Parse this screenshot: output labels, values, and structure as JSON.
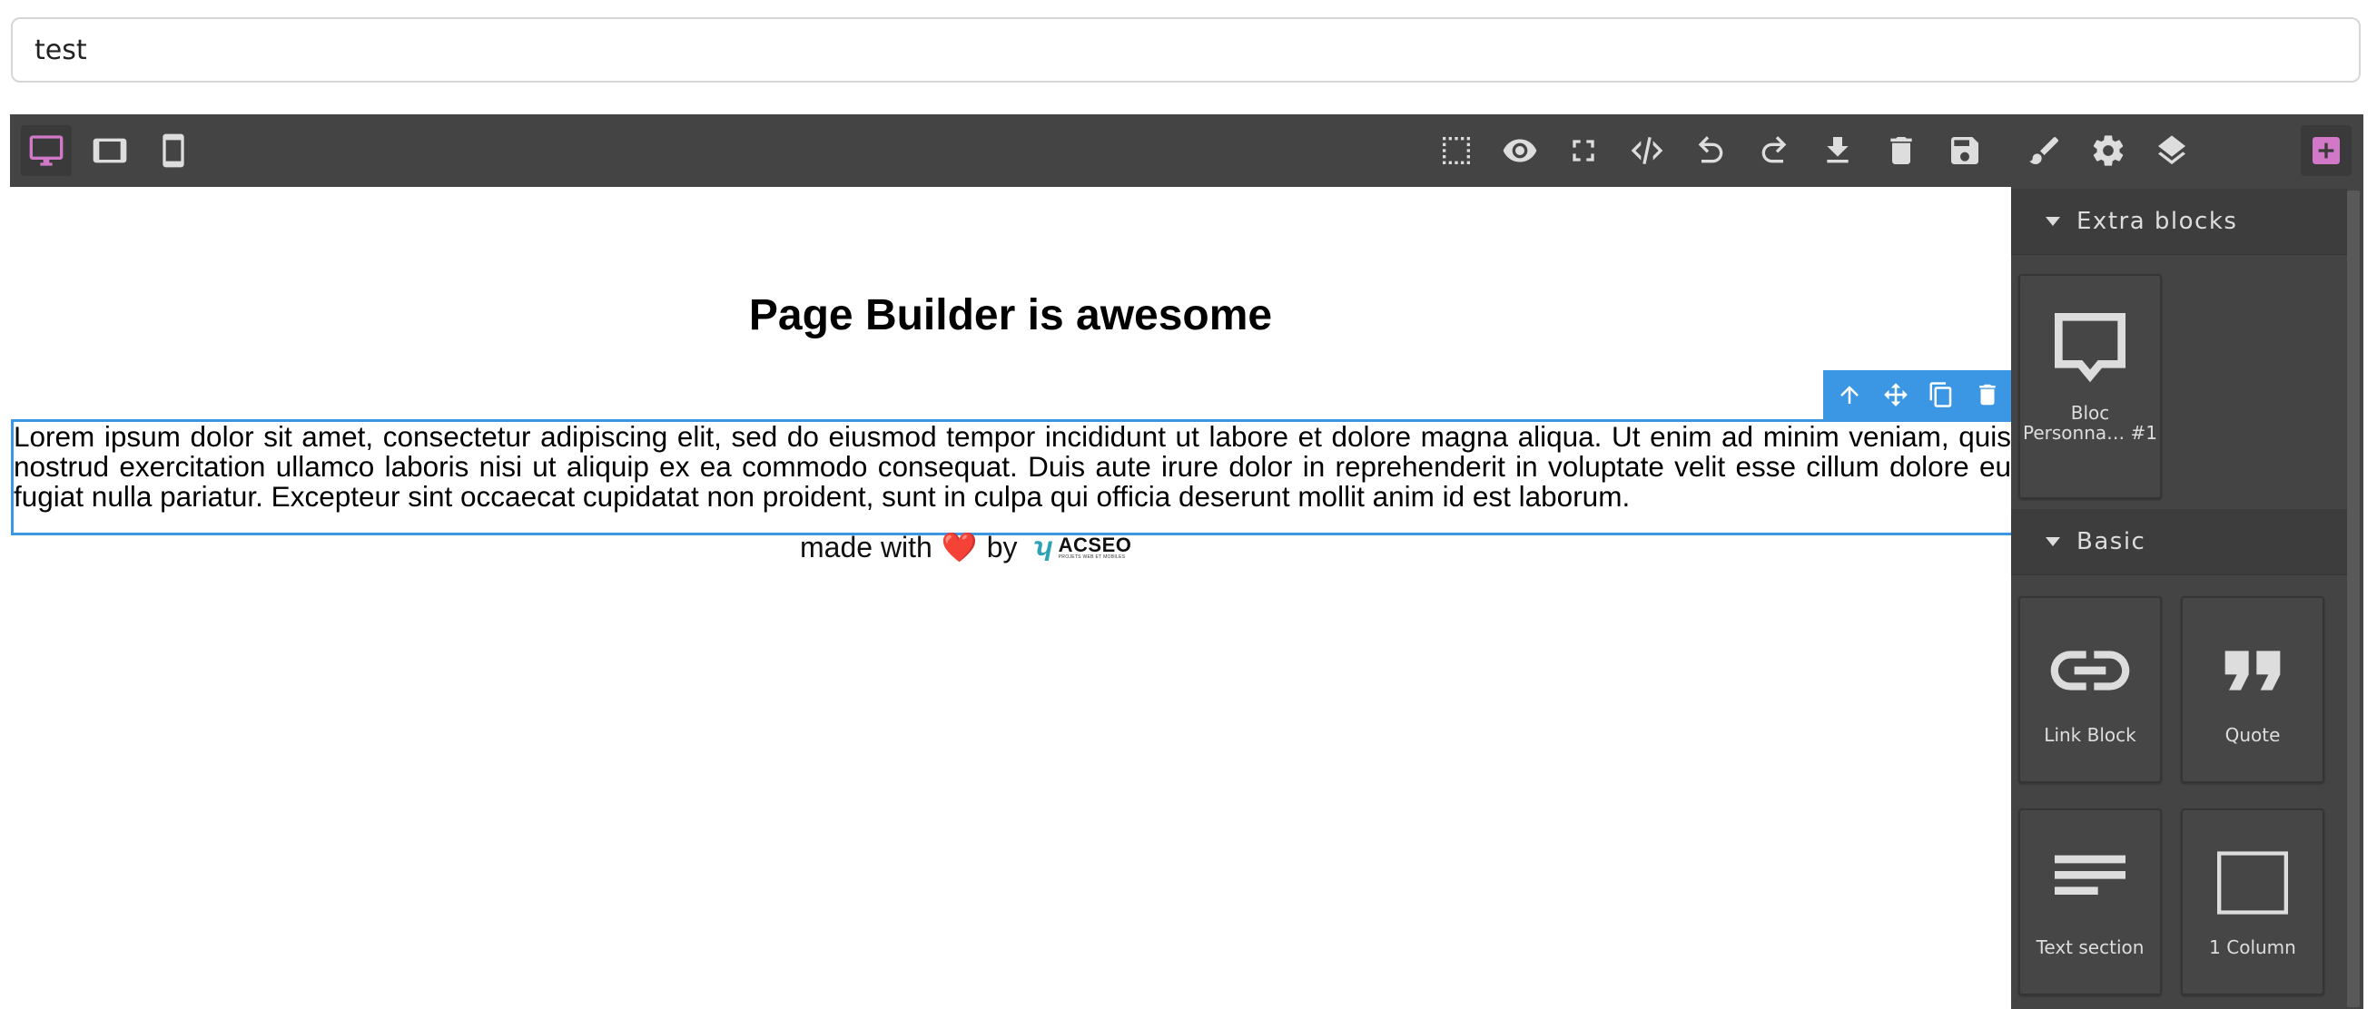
{
  "title_field": {
    "value": "test"
  },
  "toolbar": {
    "devices": [
      "desktop",
      "tablet",
      "mobile"
    ],
    "options": [
      "sw-visibility",
      "preview",
      "fullscreen",
      "export-code",
      "undo",
      "redo",
      "download",
      "clear-canvas",
      "save"
    ],
    "panels": [
      "style-manager",
      "trait-manager",
      "layer-manager",
      "block-manager"
    ]
  },
  "canvas": {
    "heading": "Page Builder is awesome",
    "paragraph": "Lorem ipsum dolor sit amet, consectetur adipiscing elit, sed do eiusmod tempor incididunt ut labore et dolore magna aliqua. Ut enim ad minim veniam, quis nostrud exercitation ullamco laboris nisi ut aliquip ex ea commodo consequat. Duis aute irure dolor in reprehenderit in voluptate velit esse cillum dolore eu fugiat nulla pariatur. Excepteur sint occaecat cupidatat non proident, sunt in culpa qui officia deserunt mollit anim id est laborum.",
    "footer_prefix": "made with",
    "footer_heart": "❤️",
    "footer_by": "by",
    "brand_name": "ACSEO",
    "brand_tagline": "PROJETS WEB ET MOBILES"
  },
  "colors": {
    "accent": "#d278c9",
    "selection": "#3b97e3",
    "panel": "#444444"
  },
  "blocks": {
    "categories": [
      {
        "name": "Extra blocks",
        "items": [
          {
            "label": "Bloc Personna… #1",
            "icon": "speech-bubble-icon"
          }
        ]
      },
      {
        "name": "Basic",
        "items": [
          {
            "label": "Link Block",
            "icon": "link-icon"
          },
          {
            "label": "Quote",
            "icon": "quote-icon"
          },
          {
            "label": "Text section",
            "icon": "text-section-icon"
          },
          {
            "label": "1 Column",
            "icon": "column-icon"
          }
        ]
      }
    ]
  }
}
